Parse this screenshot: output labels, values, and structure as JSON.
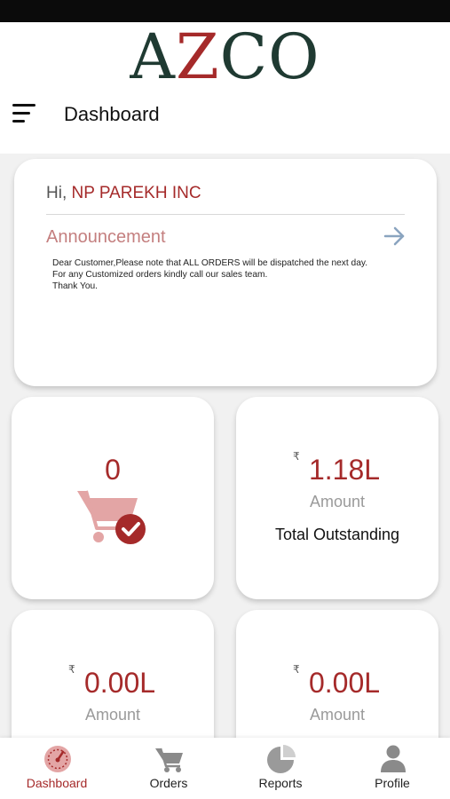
{
  "app": {
    "logo_letters": [
      "A",
      "Z",
      "CO"
    ]
  },
  "header": {
    "title": "Dashboard"
  },
  "greeting": {
    "prefix": "Hi,",
    "name": "NP PAREKH INC"
  },
  "announcement": {
    "title": "Announcement",
    "lines": [
      "Dear Customer,Please note that ALL ORDERS will be dispatched the next day.",
      "For any Customized orders kindly call our sales team.",
      "Thank You."
    ]
  },
  "tiles": [
    {
      "value": "0"
    },
    {
      "currency": "₹",
      "value": "1.18L",
      "label": "Amount",
      "caption": "Total Outstanding"
    },
    {
      "currency": "₹",
      "value": "0.00L",
      "label": "Amount"
    },
    {
      "currency": "₹",
      "value": "0.00L",
      "label": "Amount"
    }
  ],
  "nav": {
    "items": [
      {
        "label": "Dashboard",
        "icon": "gauge-icon",
        "active": true
      },
      {
        "label": "Orders",
        "icon": "cart-icon",
        "active": false
      },
      {
        "label": "Reports",
        "icon": "pie-chart-icon",
        "active": false
      },
      {
        "label": "Profile",
        "icon": "user-icon",
        "active": false
      }
    ]
  },
  "colors": {
    "accent": "#a52a2a",
    "logo_dark": "#1f3a32",
    "announcement": "#c47f7f",
    "background": "#f1f1f1"
  }
}
